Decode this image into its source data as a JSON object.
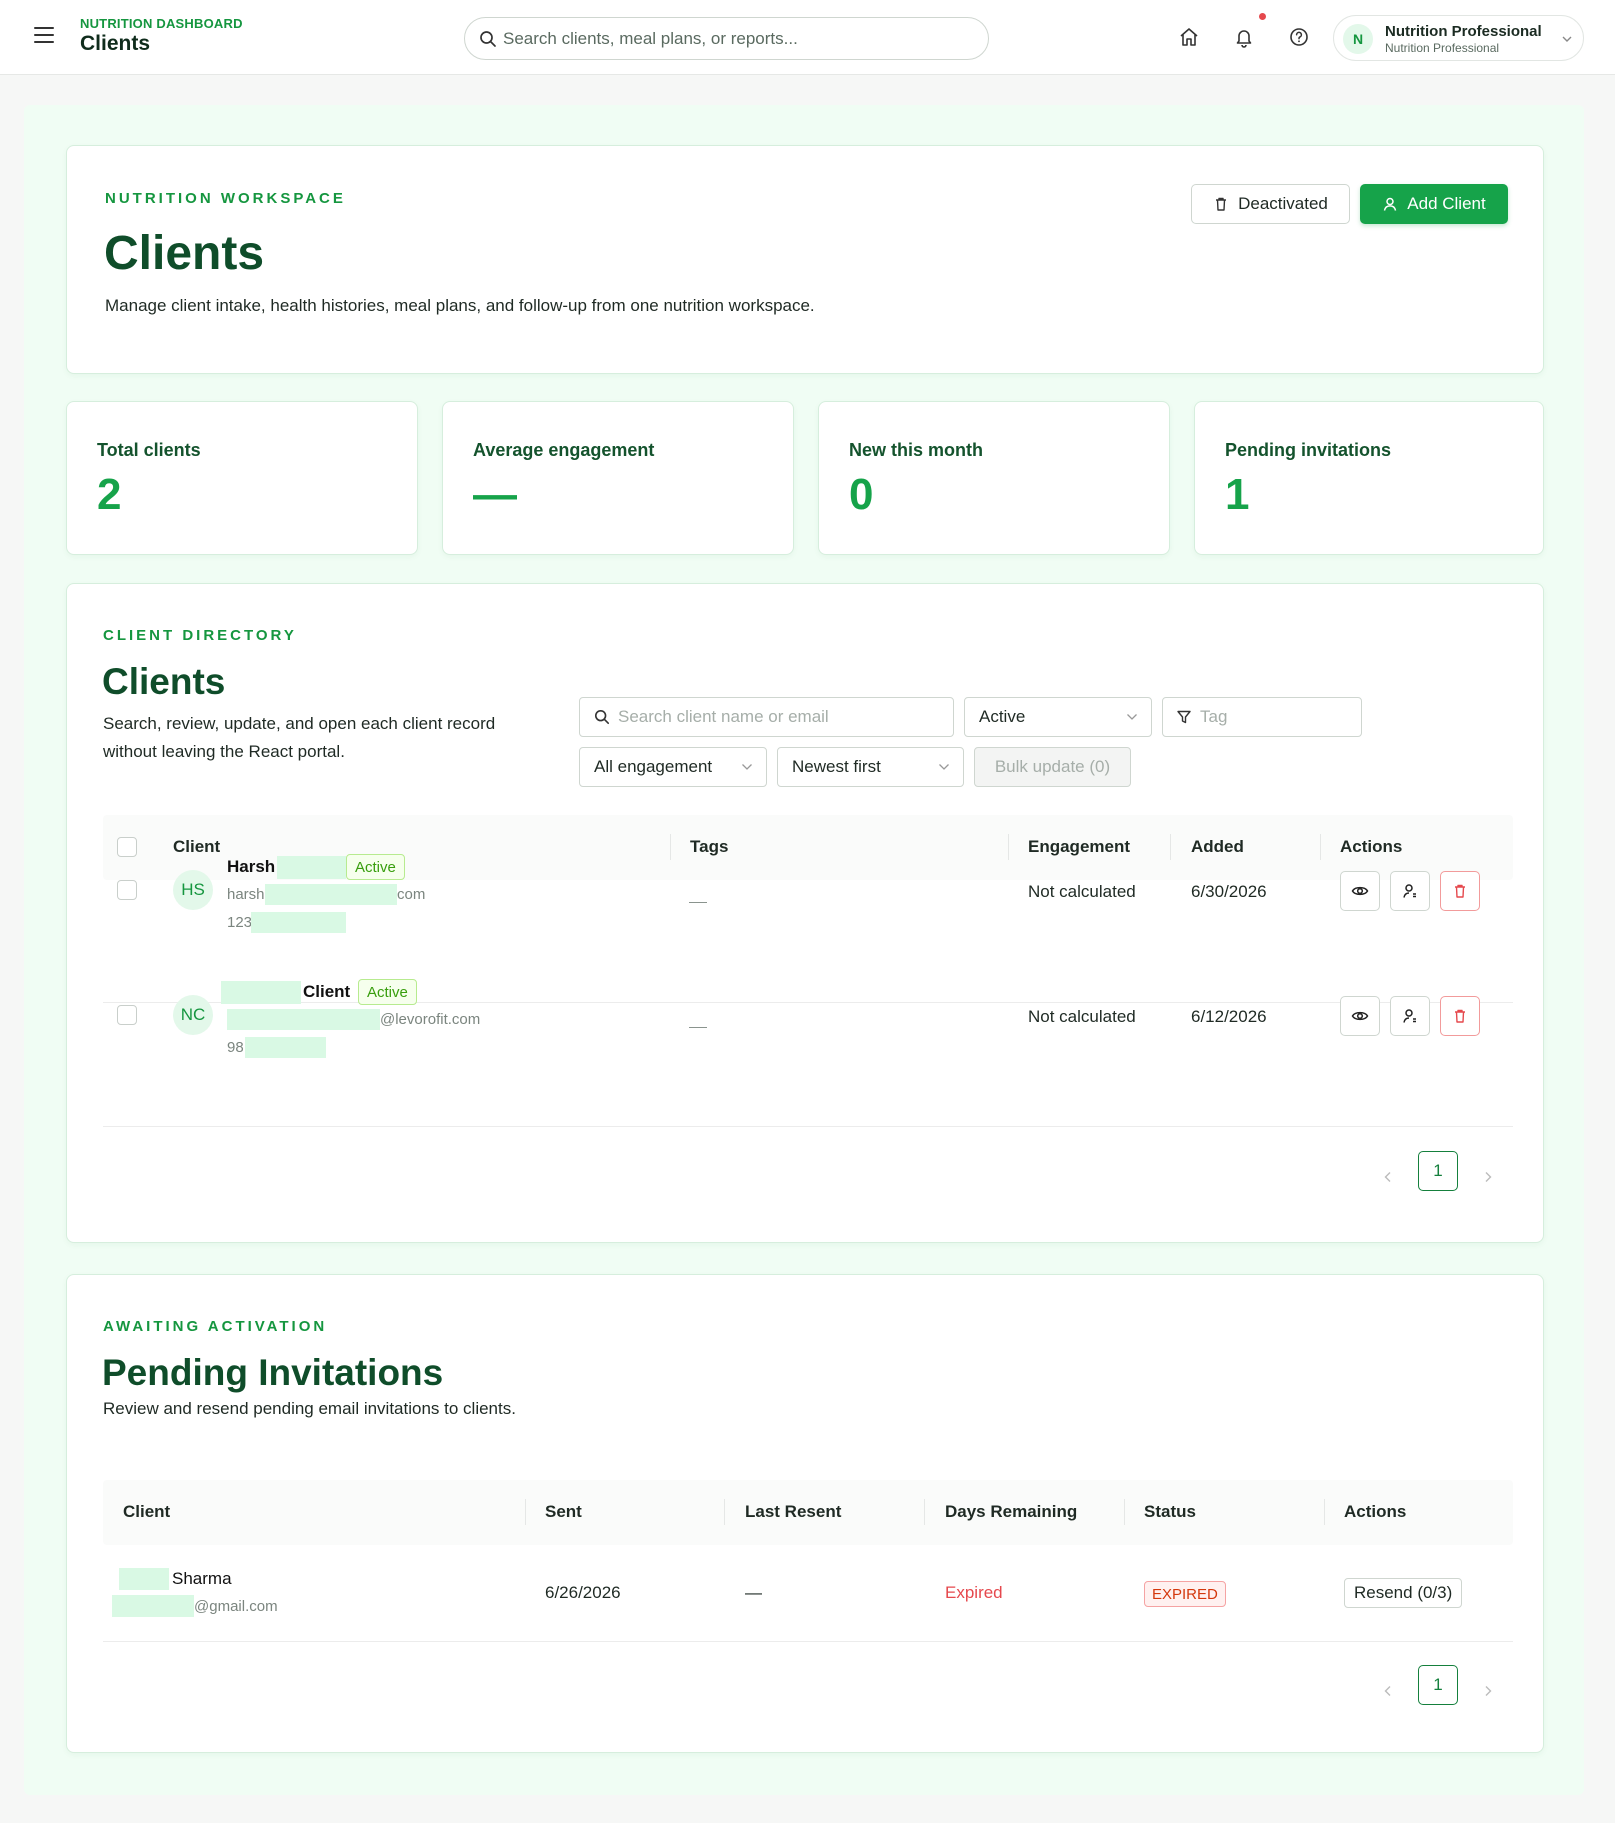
{
  "topbar": {
    "brand_eyebrow": "NUTRITION DASHBOARD",
    "brand_title": "Clients",
    "search_placeholder": "Search clients, meal plans, or reports...",
    "user": {
      "initial": "N",
      "name": "Nutrition Professional",
      "role": "Nutrition Professional"
    }
  },
  "workspace": {
    "eyebrow": "NUTRITION WORKSPACE",
    "title": "Clients",
    "description": "Manage client intake, health histories, meal plans, and follow-up from one nutrition workspace.",
    "deactivated_label": "Deactivated",
    "add_client_label": "Add Client"
  },
  "stats": [
    {
      "label": "Total clients",
      "value": "2"
    },
    {
      "label": "Average engagement",
      "value": "—"
    },
    {
      "label": "New this month",
      "value": "0"
    },
    {
      "label": "Pending invitations",
      "value": "1"
    }
  ],
  "directory": {
    "eyebrow": "CLIENT DIRECTORY",
    "title": "Clients",
    "description": "Search, review, update, and open each client record without leaving the React portal.",
    "search_placeholder": "Search client name or email",
    "status_filter": "Active",
    "tag_placeholder": "Tag",
    "engagement_filter": "All engagement",
    "sort": "Newest first",
    "bulk_update": "Bulk update (0)",
    "columns": [
      "Client",
      "Tags",
      "Engagement",
      "Added",
      "Actions"
    ],
    "rows": [
      {
        "initials": "HS",
        "name": "Harsh",
        "status": "Active",
        "email_start": "harsh",
        "email_end": "com",
        "phone": "123",
        "tags": "—",
        "engagement": "Not calculated",
        "added": "6/30/2026"
      },
      {
        "initials": "NC",
        "name": "Client",
        "status": "Active",
        "email_start": "",
        "email_end": "@levorofit.com",
        "phone": "98",
        "tags": "—",
        "engagement": "Not calculated",
        "added": "6/12/2026"
      }
    ],
    "page": "1"
  },
  "invitations": {
    "eyebrow": "AWAITING ACTIVATION",
    "title": "Pending Invitations",
    "description": "Review and resend pending email invitations to clients.",
    "columns": [
      "Client",
      "Sent",
      "Last Resent",
      "Days Remaining",
      "Status",
      "Actions"
    ],
    "rows": [
      {
        "name": "Sharma",
        "email_end": "@gmail.com",
        "sent": "6/26/2026",
        "last_resent": "—",
        "days_remaining": "Expired",
        "status": "EXPIRED",
        "action": "Resend (0/3)"
      }
    ],
    "page": "1"
  },
  "colors": {
    "accent": "#16a34a",
    "heading": "#0f4d2a",
    "danger": "#e5484d",
    "background": "#f0fdf4"
  }
}
